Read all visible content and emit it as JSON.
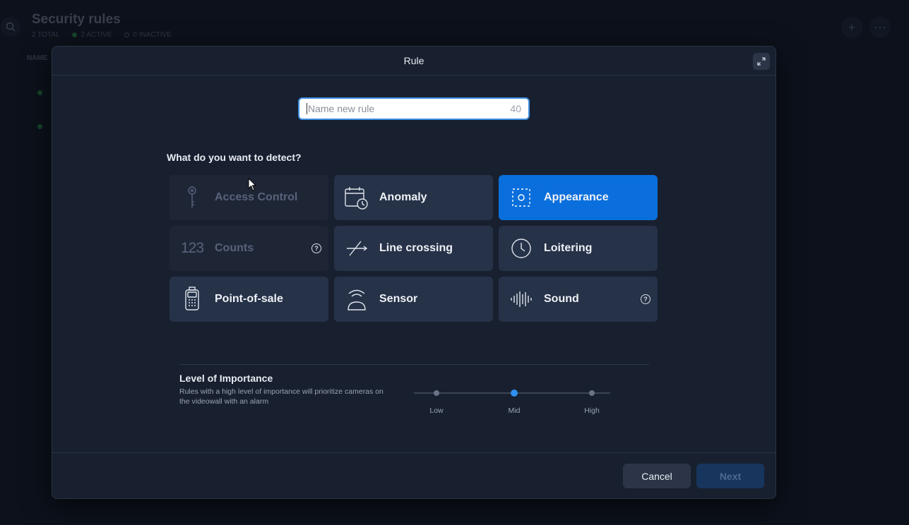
{
  "background": {
    "title": "Security rules",
    "total": "2 TOTAL",
    "active": "2 ACTIVE",
    "inactive": "0 INACTIVE",
    "column_name": "NAME",
    "add_symbol": "+",
    "more_symbol": "⋯"
  },
  "modal": {
    "title": "Rule",
    "name_input": {
      "placeholder": "Name new rule",
      "value": "",
      "char_limit": "40"
    },
    "question": "What do you want to detect?",
    "detect_options": [
      {
        "label": "Access Control",
        "icon": "key-icon",
        "state": "disabled",
        "help": false
      },
      {
        "label": "Anomaly",
        "icon": "calendar-clock-icon",
        "state": "normal",
        "help": false
      },
      {
        "label": "Appearance",
        "icon": "appearance-icon",
        "state": "selected",
        "help": false
      },
      {
        "label": "Counts",
        "icon": "numbers-icon",
        "state": "disabled",
        "help": true
      },
      {
        "label": "Line crossing",
        "icon": "line-crossing-icon",
        "state": "normal",
        "help": false
      },
      {
        "label": "Loitering",
        "icon": "clock-icon",
        "state": "normal",
        "help": false
      },
      {
        "label": "Point-of-sale",
        "icon": "pos-terminal-icon",
        "state": "normal",
        "help": false
      },
      {
        "label": "Sensor",
        "icon": "sensor-icon",
        "state": "normal",
        "help": false
      },
      {
        "label": "Sound",
        "icon": "sound-wave-icon",
        "state": "normal",
        "help": true
      }
    ],
    "counts_icon_text": "123",
    "help_symbol": "?",
    "importance": {
      "title": "Level of Importance",
      "description": "Rules with a high level of importance will prioritize cameras on the videowall with an alarm",
      "levels": [
        "Low",
        "Mid",
        "High"
      ],
      "selected": "Mid"
    },
    "cancel_label": "Cancel",
    "next_label": "Next"
  },
  "colors": {
    "accent": "#0a6fdc",
    "tile": "#263248",
    "modal_bg": "#18202f"
  }
}
